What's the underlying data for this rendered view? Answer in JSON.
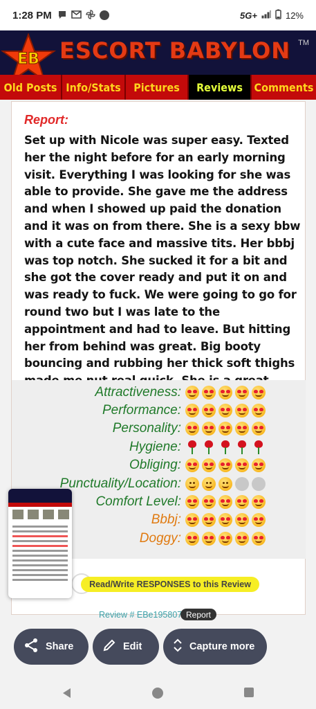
{
  "status_bar": {
    "time": "1:28 PM",
    "network": "5G+",
    "battery": "12%"
  },
  "site": {
    "logo_text": "EB",
    "brand_name": "ESCORT BABYLON",
    "trademark": "TM",
    "colors": {
      "header_bg": "#12123a",
      "brand_red": "#e43a14",
      "nav_bg": "#c30a0a",
      "nav_text": "#ffd41d"
    }
  },
  "nav": {
    "items": [
      {
        "label": "Old Posts"
      },
      {
        "label": "Info/Stats"
      },
      {
        "label": "Pictures"
      },
      {
        "label": "Reviews",
        "active": true
      },
      {
        "label": "Comments"
      }
    ]
  },
  "review": {
    "report_label": "Report:",
    "report_text": "Set up with Nicole was super easy. Texted her the night before for an early morning visit. Everything I was looking for she was able to provide. She gave me the address and when I showed up paid the donation and it was on from there. She is a sexy bbw with a cute face and massive tits. Her bbbj was top notch. She sucked it for a bit and she got the cover ready and put it on and was ready to fuck. We were going to go for round two but I was late to the appointment and had to leave. But hitting her from behind was great. Big booty bouncing and rubbing her thick soft thighs made me nut real quick. She is a great time and affordable prices. Treat her well boys.",
    "ratings": [
      {
        "label": "Attractiveness:",
        "icon": "smiley-heart-eyes",
        "score": 5,
        "of": 5
      },
      {
        "label": "Performance:",
        "icon": "smiley-heart-eyes",
        "score": 5,
        "of": 5
      },
      {
        "label": "Personality:",
        "icon": "smiley-heart-eyes",
        "score": 5,
        "of": 5
      },
      {
        "label": "Hygiene:",
        "icon": "rose",
        "score": 5,
        "of": 5
      },
      {
        "label": "Obliging:",
        "icon": "smiley-heart-eyes",
        "score": 5,
        "of": 5
      },
      {
        "label": "Punctuality/Location:",
        "icon": "smiley-plain",
        "score": 3,
        "of": 5
      },
      {
        "label": "Comfort Level:",
        "icon": "smiley-heart-eyes",
        "score": 5,
        "of": 5
      },
      {
        "label": "Bbbj:",
        "icon": "smiley-heart-eyes",
        "score": 5,
        "of": 5,
        "highlight": true
      },
      {
        "label": "Doggy:",
        "icon": "smiley-heart-eyes",
        "score": 5,
        "of": 5,
        "highlight": true
      }
    ],
    "responses_button": "Read/Write RESPONSES to this Review",
    "review_id": "Review # EBe195807",
    "report_button": "Report"
  },
  "screenshot_toolbar": {
    "share": "Share",
    "edit": "Edit",
    "capture_more": "Capture more"
  }
}
